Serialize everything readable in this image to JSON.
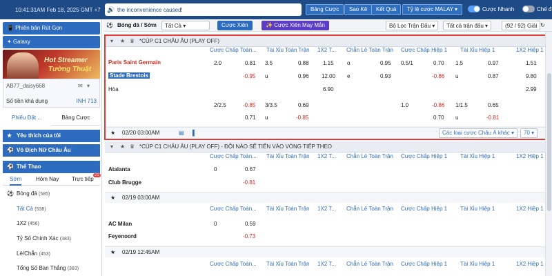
{
  "topbar": {
    "clock": "10:41:31AM Feb 18, 2025 GMT +7",
    "ticker": "the inconvenience caused!",
    "buttons": [
      "Bảng Cược",
      "Sao Kê",
      "Kết Quả",
      "Tỷ lệ cược MALAY ▾"
    ],
    "toggle1_label": "Cược Nhanh",
    "toggle2_label": "Chế đ"
  },
  "sidebar": {
    "btn_mobile": "Phiên bản Rút Gọn",
    "btn_galaxy": "Galaxy",
    "banner_line1": "Hot Streamer",
    "banner_line2": "Tường Thuật",
    "username": "AB77_daisy668",
    "balance_label": "Số tiền khả dụng",
    "currency": "INH 713",
    "tab_left": "Phiếu Đặt ...",
    "tab_right": "Bảng Cược",
    "cat_fav": "Yêu thích của tôi",
    "cat_women": "Vô Địch Nữ Châu Âu",
    "cat_sport": "Thể Thao",
    "sport_tabs": [
      "Sớm",
      "Hôm Nay",
      "Trực tiếp"
    ],
    "live_badge": "21",
    "sport_items": [
      {
        "label": "Bóng đá",
        "count": "(585)"
      },
      {
        "label": "Tất Cả",
        "count": "(538)"
      },
      {
        "label": "1X2",
        "count": "(456)"
      },
      {
        "label": "Tỷ Số Chính Xác",
        "count": "(383)"
      },
      {
        "label": "Lẻ/Chẵn",
        "count": "(453)"
      },
      {
        "label": "Tổng Số Bàn Thắng",
        "count": "(383)"
      }
    ]
  },
  "filterbar": {
    "sport": "Bóng đá / Sớm",
    "scope": "Tất Cả",
    "btn_parlay": "Cược Xiên",
    "btn_lucky": "Cược Xiên May Mắn",
    "filter_match": "Bộ Lọc Trận Đấu",
    "all_matches": "Tất cả trận đấu",
    "count": "(92 / 92) Giải"
  },
  "columns": [
    "Cược Chấp Toàn...",
    "Tài Xỉu Toàn Trận",
    "1X2 T...",
    "Chẵn Lẻ Toàn Trận",
    "Cược Chấp Hiệp 1",
    "Tài Xỉu Hiệp 1",
    "1X2 Hiệp 1"
  ],
  "leagues": [
    {
      "title": "*CÚP C1 CHÂU ÂU (PLAY OFF)",
      "home": "Paris Saint Germain",
      "away": "Stade Brestois",
      "draw": "Hòa",
      "row1": [
        "2.0",
        "0.81",
        "3.5",
        "0.88",
        "1.15",
        "o",
        "0.95",
        "0.5/1",
        "0.70",
        "1.5",
        "0.97",
        "1.51"
      ],
      "row2": [
        "-0.95",
        "u",
        "0.96",
        "12.00",
        "e",
        "0.93",
        "-0.86",
        "u",
        "0.87",
        "9.80"
      ],
      "row3": [
        "6.90",
        "2.99"
      ],
      "row4": [
        "2/2.5",
        "-0.85",
        "3/3.5",
        "0.69",
        "1.0",
        "-0.86",
        "1/1.5",
        "0.65"
      ],
      "row5": [
        "0.71",
        "u",
        "-0.85",
        "0.70",
        "u",
        "-0.81"
      ],
      "time": "02/20 03:00AM",
      "more": "Các loại cược Châu Á khác ▾",
      "more_count": "70 ▾"
    },
    {
      "title": "*CÚP C1 CHÂU ÂU (PLAY OFF) - ĐỘI NÀO SẼ TIẾN VÀO VÒNG TIẾP THEO",
      "home": "Atalanta",
      "away": "Club Brugge",
      "odds_home": [
        "0",
        "0.67"
      ],
      "odds_away": "-0.81",
      "time": "02/19 03:00AM"
    },
    {
      "home": "AC Milan",
      "away": "Feyenoord",
      "odds_home": [
        "0",
        "0.59"
      ],
      "odds_away": "-0.73",
      "time": "02/19 12:45AM"
    }
  ],
  "colors": {
    "topbar": "#1e4a86",
    "accent": "#2d6bbf",
    "negative": "#d9261c",
    "highlight_border": "#e53935",
    "team_home": "#d9261c"
  }
}
